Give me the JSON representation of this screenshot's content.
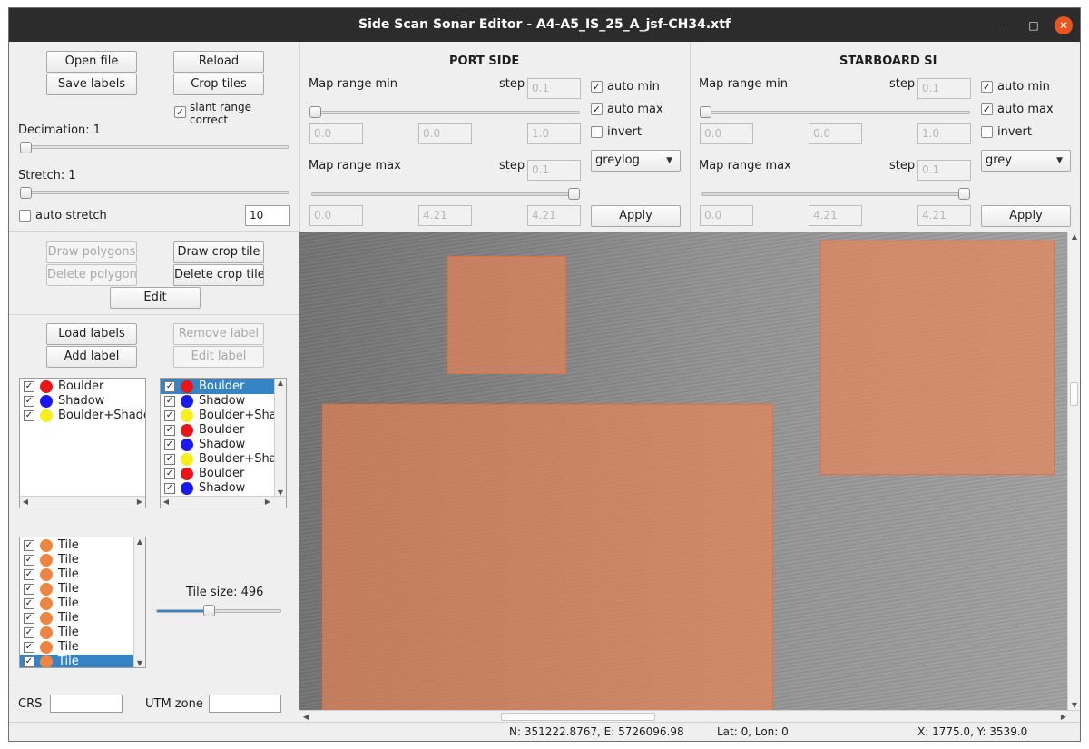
{
  "window": {
    "title": "Side Scan Sonar Editor - A4-A5_IS_25_A_jsf-CH34.xtf"
  },
  "file_panel": {
    "open_file": "Open file",
    "reload": "Reload",
    "save_labels": "Save labels",
    "crop_tiles": "Crop tiles",
    "slant_range_line1": "slant range",
    "slant_range_line2": "correct",
    "decimation_label": "Decimation: 1",
    "stretch_label": "Stretch: 1",
    "auto_stretch": "auto stretch",
    "auto_stretch_value": "10"
  },
  "port_side": {
    "header": "PORT SIDE",
    "map_range_min": "Map range min",
    "step": "step",
    "step_min_value": "0.1",
    "auto_min": "auto min",
    "auto_max": "auto max",
    "invert": "invert",
    "min_fields": [
      "0.0",
      "0.0",
      "1.0"
    ],
    "colormap": "greylog",
    "map_range_max": "Map range max",
    "step_max_value": "0.1",
    "max_fields": [
      "0.0",
      "4.21",
      "4.21"
    ],
    "apply": "Apply"
  },
  "starboard_side": {
    "header": "STARBOARD SI",
    "map_range_min": "Map range min",
    "step": "step",
    "step_min_value": "0.1",
    "auto_min": "auto min",
    "auto_max": "auto max",
    "invert": "invert",
    "min_fields": [
      "0.0",
      "0.0",
      "1.0"
    ],
    "colormap": "grey",
    "map_range_max": "Map range max",
    "step_max_value": "0.1",
    "max_fields": [
      "0.0",
      "4.21",
      "4.21"
    ],
    "apply": "Apply"
  },
  "drawing_panel": {
    "draw_polygons": "Draw polygons",
    "draw_crop_tile": "Draw crop tile",
    "delete_polygons": "Delete polygons",
    "delete_crop_tile": "Delete crop tile",
    "edit": "Edit"
  },
  "labels_panel": {
    "load_labels": "Load labels",
    "remove_label": "Remove label",
    "add_label": "Add label",
    "edit_label": "Edit label",
    "label_classes": [
      {
        "name": "Boulder",
        "color": "#e8151b"
      },
      {
        "name": "Shadow",
        "color": "#1a1aee"
      },
      {
        "name": "Boulder+Shadow",
        "color": "#f5f01a"
      }
    ],
    "polygon_list": [
      {
        "name": "Boulder",
        "color": "#e8151b"
      },
      {
        "name": "Shadow",
        "color": "#1a1aee"
      },
      {
        "name": "Boulder+Shadow",
        "color": "#f5f01a"
      },
      {
        "name": "Boulder",
        "color": "#e8151b"
      },
      {
        "name": "Shadow",
        "color": "#1a1aee"
      },
      {
        "name": "Boulder+Shadow",
        "color": "#f5f01a"
      },
      {
        "name": "Boulder",
        "color": "#e8151b"
      },
      {
        "name": "Shadow",
        "color": "#1a1aee"
      }
    ]
  },
  "tiles_panel": {
    "tiles": [
      "Tile",
      "Tile",
      "Tile",
      "Tile",
      "Tile",
      "Tile",
      "Tile",
      "Tile",
      "Tile"
    ],
    "tile_color": "#ef8543",
    "tile_size_label": "Tile size: 496",
    "tile_size_slider_fraction": 0.42
  },
  "crs_panel": {
    "crs_label": "CRS",
    "utm_zone_label": "UTM zone"
  },
  "statusbar": {
    "northing_easting": "N:  351222.8767, E:  5726096.98",
    "lat_lon": "Lat: 0, Lon: 0",
    "xy": "X: 1775.0, Y: 3539.0"
  }
}
